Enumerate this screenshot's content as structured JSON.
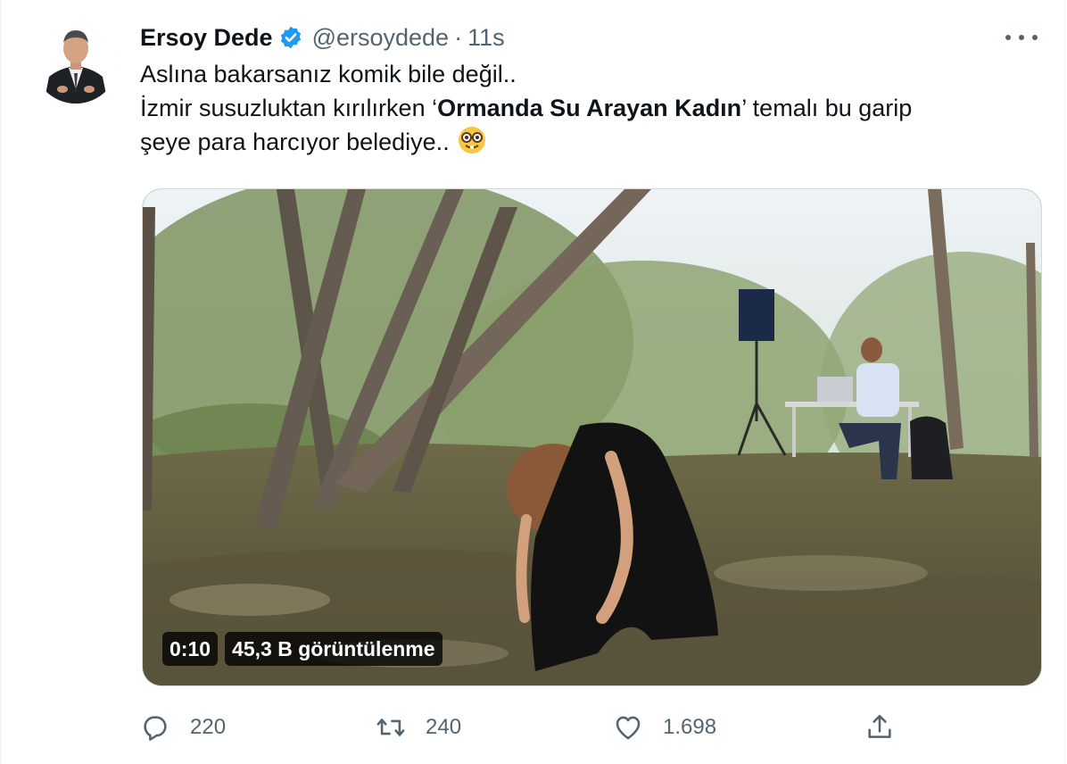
{
  "tweet": {
    "author": {
      "name": "Ersoy Dede",
      "handle": "@ersoydede",
      "separator": "·",
      "time": "11s",
      "verified": true
    },
    "text": {
      "line1": "Aslına bakarsanız komik bile değil..",
      "line2_prefix": "İzmir susuzluktan kırılırken ‘",
      "line2_bold": "Ormanda Su Arayan Kadın",
      "line2_suffix": "’ temalı bu garip",
      "line3": "şeye para harcıyor belediye..",
      "emoji": "nerd-face-emoji"
    },
    "media": {
      "type": "video",
      "duration": "0:10",
      "views": "45,3 B görüntülenme"
    },
    "actions": {
      "reply_count": "220",
      "retweet_count": "240",
      "like_count": "1.698"
    }
  },
  "colors": {
    "verified": "#1d9bf0",
    "secondary_text": "#536471",
    "primary_text": "#0f1419"
  },
  "icons": [
    "verified-badge-icon",
    "more-icon",
    "reply-icon",
    "retweet-icon",
    "like-icon",
    "share-icon"
  ]
}
